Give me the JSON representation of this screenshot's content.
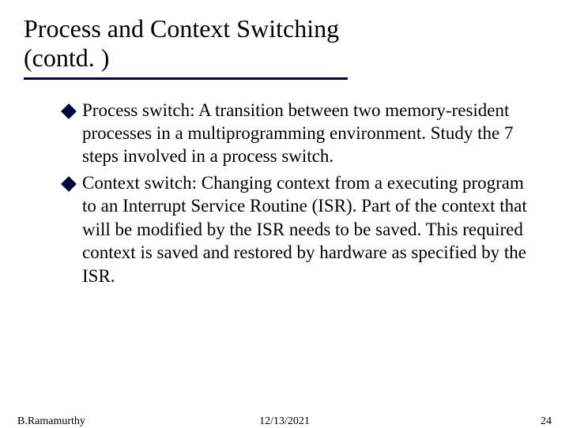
{
  "title_line1": "Process and Context Switching",
  "title_line2": "(contd. )",
  "bullets": [
    "Process switch: A transition between two memory-resident processes in a multiprogramming environment. Study the 7 steps involved in a process switch.",
    "Context switch: Changing context from a executing program to an Interrupt Service Routine (ISR). Part of the context that will be modified by the ISR needs to be saved. This required context is saved and restored by hardware as specified by the ISR."
  ],
  "footer": {
    "author": "B.Ramamurthy",
    "date": "12/13/2021",
    "page": "24"
  }
}
